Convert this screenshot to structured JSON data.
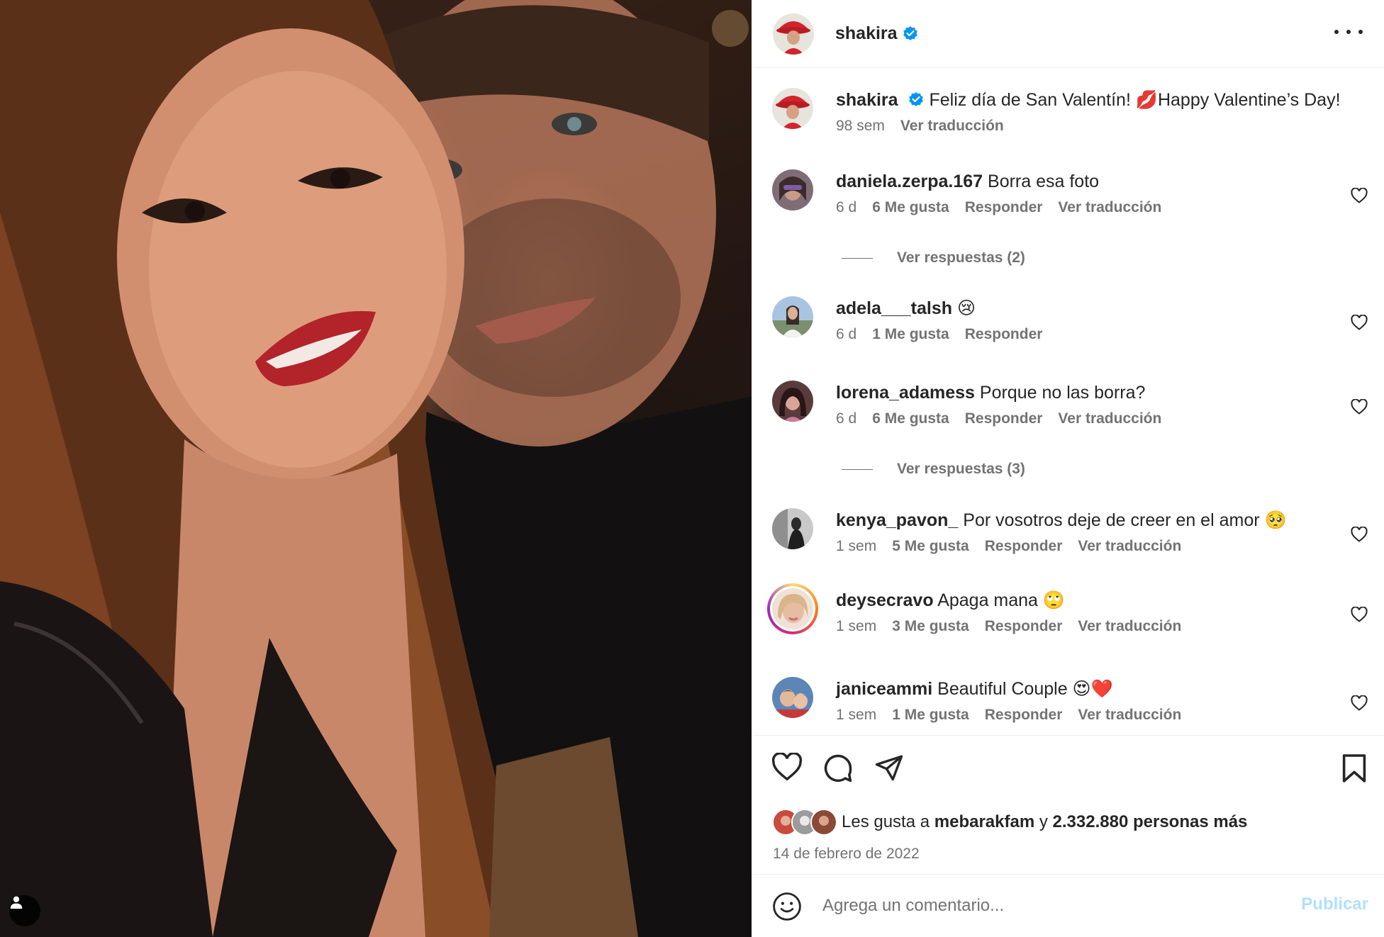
{
  "colors": {
    "verified": "#0095f6",
    "heart_red": "#e0245e",
    "publish_disabled": "#b2dffc",
    "muted": "#737373"
  },
  "post": {
    "author": "shakira",
    "verified": true,
    "caption": "Feliz día de San Valentín! 💋Happy Valentine’s Day!",
    "caption_age": "98 sem",
    "caption_translate": "Ver traducción"
  },
  "comments": [
    {
      "user": "daniela.zerpa.167",
      "text": "Borra esa foto",
      "age": "6 d",
      "likes": "6 Me gusta",
      "reply": "Responder",
      "translate": "Ver traducción"
    },
    {
      "user": "adela___talsh",
      "text": "😢",
      "age": "6 d",
      "likes": "1 Me gusta",
      "reply": "Responder",
      "translate": ""
    },
    {
      "user": "lorena_adamess",
      "text": "Porque no las borra?",
      "age": "6 d",
      "likes": "6 Me gusta",
      "reply": "Responder",
      "translate": "Ver traducción"
    },
    {
      "user": "kenya_pavon_",
      "text": "Por vosotros deje de creer en el amor 🥺",
      "age": "1 sem",
      "likes": "5 Me gusta",
      "reply": "Responder",
      "translate": "Ver traducción"
    },
    {
      "user": "deysecravo",
      "text": "Apaga mana 🙄",
      "age": "1 sem",
      "likes": "3 Me gusta",
      "reply": "Responder",
      "translate": "Ver traducción"
    },
    {
      "user": "janiceammi",
      "text": "Beautiful Couple 😍❤️",
      "age": "1 sem",
      "likes": "1 Me gusta",
      "reply": "Responder",
      "translate": "Ver traducción"
    }
  ],
  "replies": [
    {
      "label": "Ver respuestas (2)"
    },
    {
      "label": "Ver respuestas (3)"
    }
  ],
  "likes_summary": {
    "prefix": "Les gusta a",
    "first_user": "mebarakfam",
    "connector": "y",
    "count": "2.332.880 personas más"
  },
  "date": "14 de febrero de 2022",
  "comment_box": {
    "placeholder": "Agrega un comentario...",
    "publish": "Publicar"
  }
}
